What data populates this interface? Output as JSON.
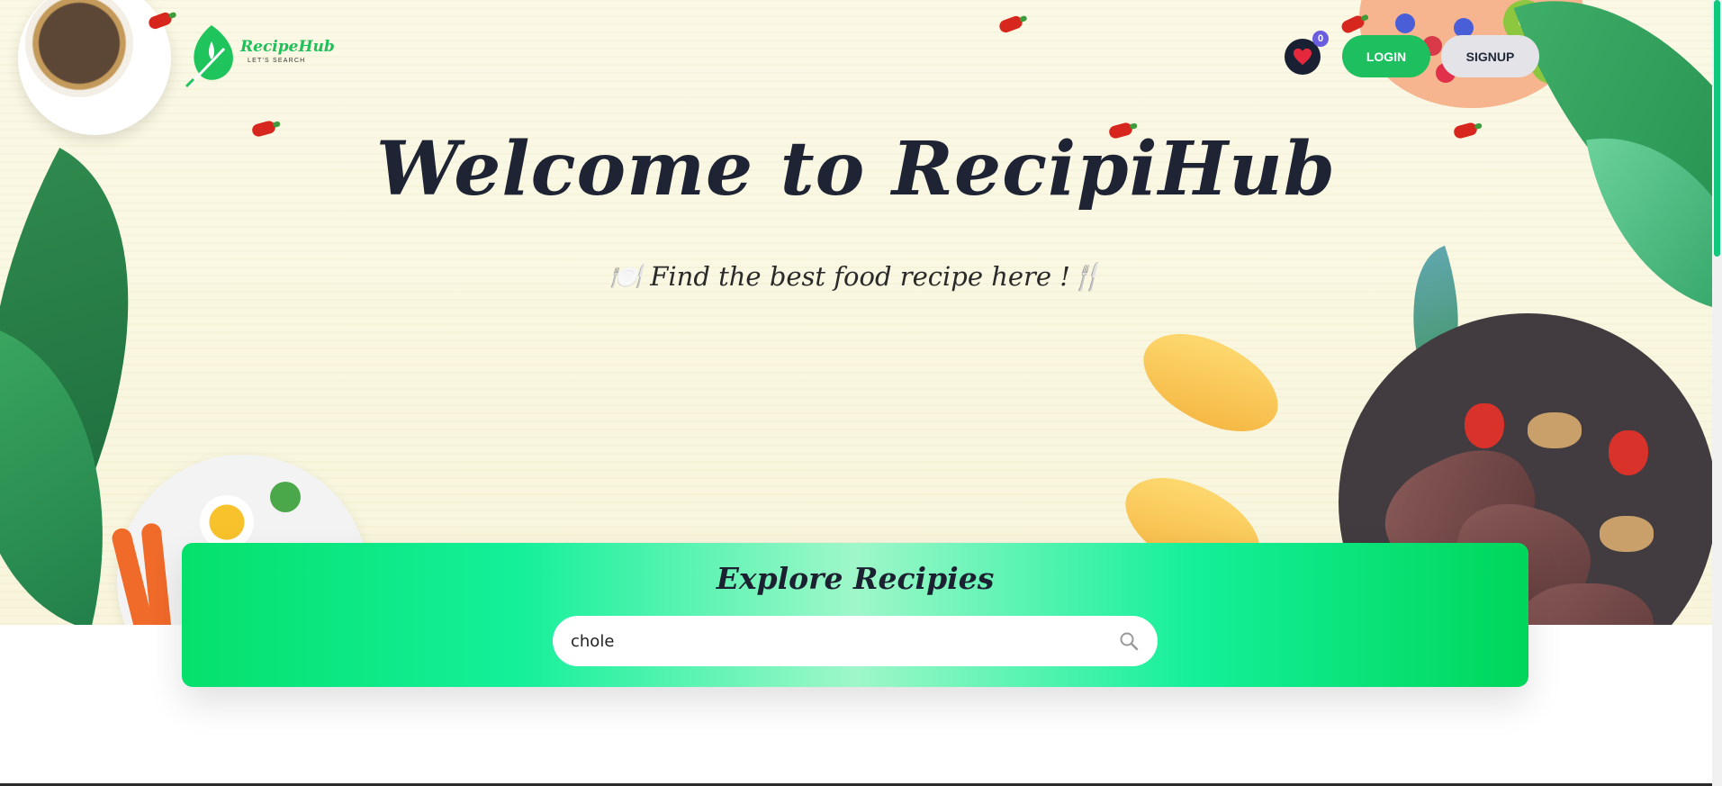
{
  "brand": {
    "name": "RecipeHub",
    "tagline": "LET'S SEARCH"
  },
  "header": {
    "favorites_count": "0",
    "login_label": "LOGIN",
    "signup_label": "SIGNUP"
  },
  "hero": {
    "title": "Welcome to RecipiHub",
    "subtitle": "🍽️ Find the best food recipe here !🍴"
  },
  "explore": {
    "title": "Explore Recipies",
    "search_value": "chole"
  },
  "colors": {
    "accent_green": "#1dbf5e",
    "navy": "#1a2033",
    "badge": "#6a5de0",
    "heart": "#e5283c"
  },
  "icons": {
    "favorites": "heart-icon",
    "search": "search-icon",
    "logo": "leaf-fork-icon"
  }
}
